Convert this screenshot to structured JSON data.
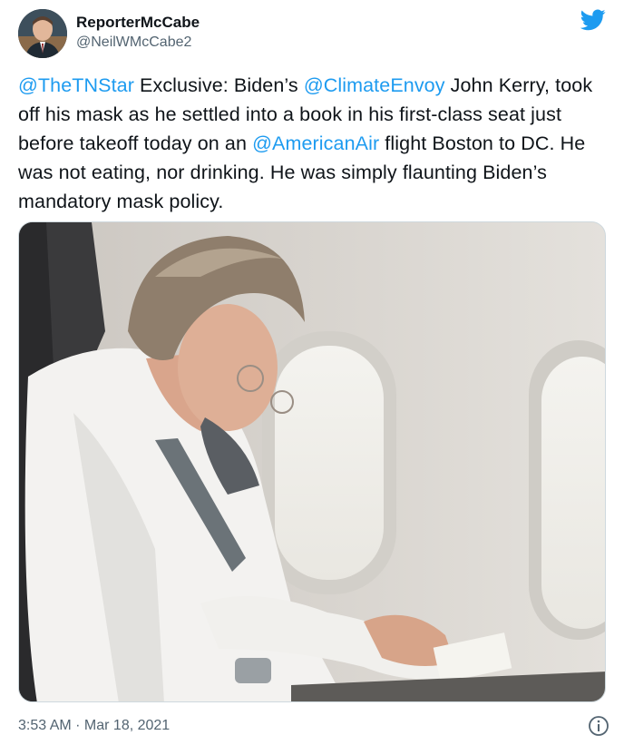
{
  "author": {
    "display_name": "ReporterMcCabe",
    "handle": "@NeilWMcCabe2"
  },
  "tweet": {
    "mention_1": "@TheTNStar",
    "text_1": " Exclusive: Biden’s ",
    "mention_2": "@ClimateEnvoy",
    "text_2": " John Kerry, took off his mask as he settled into a book in his first-class seat just before takeoff today on an ",
    "mention_3": "@AmericanAir",
    "text_3": " flight Boston to DC. He was not eating, nor drinking. He was simply flaunting Biden’s mandatory mask policy."
  },
  "footer": {
    "time": "3:53 AM",
    "separator": " · ",
    "date": "Mar 18, 2021"
  },
  "icons": {
    "logo": "twitter-bird-icon",
    "info": "info-icon"
  },
  "colors": {
    "link": "#1d9bf0",
    "text": "#0f1419",
    "secondary": "#536471",
    "border": "#cfd9de"
  }
}
